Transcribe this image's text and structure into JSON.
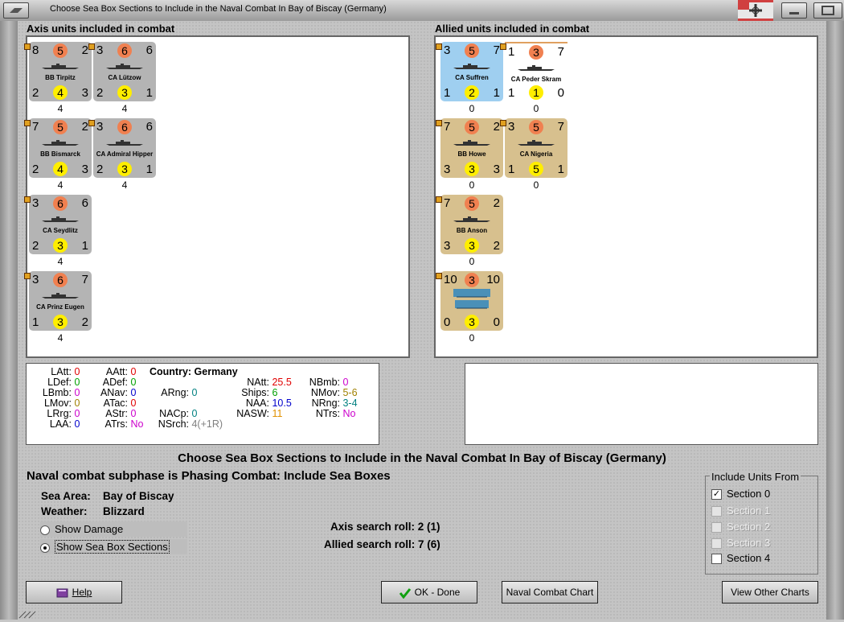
{
  "window": {
    "title": "Choose Sea Box Sections to Include in the Naval Combat In Bay of Biscay (Germany)"
  },
  "axis_panel": {
    "heading": "Axis units included in combat",
    "units": [
      {
        "tl": "8",
        "top": "5",
        "tr": "2",
        "name": "BB Tirpitz",
        "bl": "2",
        "bot": "4",
        "br": "3",
        "under": "4",
        "color": "grey"
      },
      {
        "tl": "3",
        "top": "6",
        "tr": "6",
        "name": "CA Lützow",
        "bl": "2",
        "bot": "3",
        "br": "1",
        "under": "4",
        "color": "grey"
      },
      {
        "tl": "7",
        "top": "5",
        "tr": "2",
        "name": "BB Bismarck",
        "bl": "2",
        "bot": "4",
        "br": "3",
        "under": "4",
        "color": "grey"
      },
      {
        "tl": "3",
        "top": "6",
        "tr": "6",
        "name": "CA Admiral Hipper",
        "bl": "2",
        "bot": "3",
        "br": "1",
        "under": "4",
        "color": "grey"
      },
      {
        "tl": "3",
        "top": "6",
        "tr": "6",
        "name": "CA Seydlitz",
        "bl": "2",
        "bot": "3",
        "br": "1",
        "under": "4",
        "color": "grey"
      },
      {
        "tl": "3",
        "top": "6",
        "tr": "7",
        "name": "CA Prinz Eugen",
        "bl": "1",
        "bot": "3",
        "br": "2",
        "under": "4",
        "color": "grey"
      }
    ]
  },
  "allied_panel": {
    "heading": "Allied units included in combat",
    "units": [
      {
        "tl": "3",
        "top": "5",
        "tr": "7",
        "name": "CA Suffren",
        "bl": "1",
        "bot": "2",
        "br": "1",
        "under": "0",
        "color": "blue"
      },
      {
        "tl": "1",
        "top": "3",
        "tr": "7",
        "name": "CA Peder Skram",
        "bl": "1",
        "bot": "1",
        "br": "0",
        "under": "0",
        "color": "white"
      },
      {
        "tl": "7",
        "top": "5",
        "tr": "2",
        "name": "BB Howe",
        "bl": "3",
        "bot": "3",
        "br": "3",
        "under": "0",
        "color": "tan"
      },
      {
        "tl": "3",
        "top": "5",
        "tr": "7",
        "name": "CA Nigeria",
        "bl": "1",
        "bot": "5",
        "br": "1",
        "under": "0",
        "color": "tan"
      },
      {
        "tl": "7",
        "top": "5",
        "tr": "2",
        "name": "BB Anson",
        "bl": "3",
        "bot": "3",
        "br": "2",
        "under": "0",
        "color": "tan"
      },
      {
        "tl": "10",
        "top": "3",
        "tr": "10",
        "name": "",
        "bl": "0",
        "bot": "3",
        "br": "0",
        "under": "0",
        "color": "tan"
      }
    ]
  },
  "stats": {
    "latt_l": "LAtt:",
    "latt_v": "0",
    "aatt_l": "AAtt:",
    "aatt_v": "0",
    "ldef_l": "LDef:",
    "ldef_v": "0",
    "adef_l": "ADef:",
    "adef_v": "0",
    "lbmb_l": "LBmb:",
    "lbmb_v": "0",
    "anav_l": "ANav:",
    "anav_v": "0",
    "lmov_l": "LMov:",
    "lmov_v": "0",
    "atac_l": "ATac:",
    "atac_v": "0",
    "lrrg_l": "LRrg:",
    "lrrg_v": "0",
    "astr_l": "AStr:",
    "astr_v": "0",
    "laa_l": "LAA:",
    "laa_v": "0",
    "atrs_l": "ATrs:",
    "atrs_v": "No",
    "country": "Country: Germany",
    "arng_l": "ARng:",
    "arng_v": "0",
    "nacp_l": "NACp:",
    "nacp_v": "0",
    "nsrch_l": "NSrch:",
    "nsrch_v": "4(+1R)",
    "natt_l": "NAtt:",
    "natt_v": "25.5",
    "ships_l": "Ships:",
    "ships_v": "6",
    "naa_l": "NAA:",
    "naa_v": "10.5",
    "nasw_l": "NASW:",
    "nasw_v": "11",
    "nbmb_l": "NBmb:",
    "nbmb_v": "0",
    "nmov_l": "NMov:",
    "nmov_v": "5-6",
    "nrng_l": "NRng:",
    "nrng_v": "3-4",
    "ntrs_l": "NTrs:",
    "ntrs_v": "No"
  },
  "bottom": {
    "main_title": "Choose Sea Box Sections to Include in the Naval Combat In Bay of Biscay (Germany)",
    "subphase": "Naval combat subphase is Phasing Combat: Include Sea Boxes",
    "sea_area_label": "Sea Area:",
    "sea_area_value": "Bay of Biscay",
    "weather_label": "Weather:",
    "weather_value": "Blizzard",
    "show_damage": "Show Damage",
    "show_sections": "Show Sea Box Sections",
    "axis_roll": "Axis search roll: 2 (1)",
    "allied_roll": "Allied search roll: 7 (6)",
    "include_title": "Include Units From",
    "sections": [
      "Section 0",
      "Section 1",
      "Section 2",
      "Section 3",
      "Section 4"
    ]
  },
  "buttons": {
    "help": "Help",
    "ok": "OK - Done",
    "naval_chart": "Naval Combat Chart",
    "other_charts": "View Other Charts"
  },
  "colors": {
    "red": "#e00000",
    "green": "#00a000",
    "magenta": "#cc00cc",
    "olive": "#a08000",
    "blue": "#0000cc",
    "teal": "#008080"
  }
}
